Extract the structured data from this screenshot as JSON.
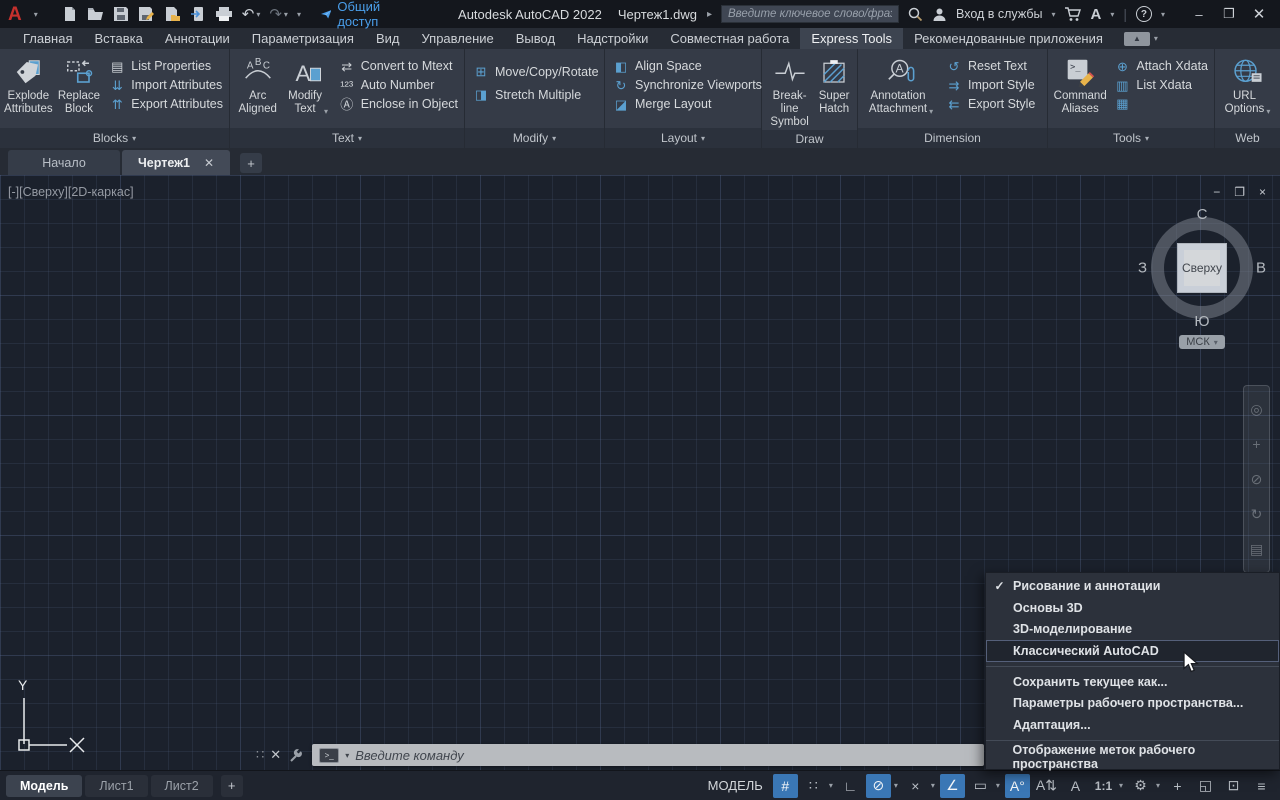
{
  "titlebar": {
    "share": "Общий доступ",
    "app_title": "Autodesk AutoCAD 2022",
    "doc_name": "Чертеж1.dwg",
    "search_placeholder": "Введите ключевое слово/фразу",
    "signin": "Вход в службы"
  },
  "icons": {
    "caret": "▾",
    "check": "✓",
    "undo": "↶",
    "redo": "↷",
    "grip": "∷",
    "minimize": "–",
    "restore": "❐",
    "close": "✕",
    "vp_minimize": "−",
    "vp_restore": "❐",
    "vp_close": "×",
    "arrow_right": "▸",
    "help": "?",
    "logo_a": "A",
    "autodesk_a": "A",
    "ribbon_min": "▲",
    "plus": "+",
    "prompt": ">_",
    "hamburger": "≡"
  },
  "menubar": {
    "tabs": [
      {
        "name": "tab-home",
        "label": "Главная"
      },
      {
        "name": "tab-insert",
        "label": "Вставка"
      },
      {
        "name": "tab-annotate",
        "label": "Аннотации"
      },
      {
        "name": "tab-parametric",
        "label": "Параметризация"
      },
      {
        "name": "tab-view",
        "label": "Вид"
      },
      {
        "name": "tab-manage",
        "label": "Управление"
      },
      {
        "name": "tab-output",
        "label": "Вывод"
      },
      {
        "name": "tab-addins",
        "label": "Надстройки"
      },
      {
        "name": "tab-collaborate",
        "label": "Совместная работа"
      },
      {
        "name": "tab-express-tools",
        "label": "Express Tools",
        "active": true
      },
      {
        "name": "tab-featured-apps",
        "label": "Рекомендованные приложения"
      }
    ]
  },
  "ribbon": {
    "panels": {
      "blocks": {
        "label": "Blocks",
        "caret": "▾",
        "big": [
          {
            "l1": "Explode",
            "l2": "Attributes"
          },
          {
            "l1": "Replace",
            "l2": "Block"
          }
        ],
        "small": [
          {
            "label": "List Properties",
            "glyph": "▤"
          },
          {
            "label": "Import Attributes",
            "glyph": "⇊"
          },
          {
            "label": "Export Attributes",
            "glyph": "⇈"
          }
        ]
      },
      "text": {
        "label": "Text",
        "caret": "▾",
        "big": [
          {
            "l1": "Arc",
            "l2": "Aligned"
          },
          {
            "l1": "Modify",
            "l2": "Text",
            "caret": "▾"
          }
        ],
        "small": [
          {
            "label": "Convert to Mtext",
            "glyph": "⇄"
          },
          {
            "label": "Auto Number",
            "glyph": "¹²³"
          },
          {
            "label": "Enclose in Object",
            "glyph": "Ⓐ"
          }
        ]
      },
      "modify": {
        "label": "Modify",
        "caret": "▾",
        "small": [
          {
            "label": "Move/Copy/Rotate",
            "glyph": "⊞"
          },
          {
            "label": "Stretch Multiple",
            "glyph": "◨"
          }
        ]
      },
      "layout": {
        "label": "Layout",
        "caret": "▾",
        "small": [
          {
            "label": "Align Space",
            "glyph": "◧"
          },
          {
            "label": "Synchronize Viewports",
            "glyph": "↻"
          },
          {
            "label": "Merge Layout",
            "glyph": "◪"
          }
        ]
      },
      "draw": {
        "label": "Draw",
        "big": [
          {
            "l1": "Break-line",
            "l2": "Symbol"
          },
          {
            "l1": "Super",
            "l2": "Hatch"
          }
        ]
      },
      "dimension": {
        "label": "Dimension",
        "big": [
          {
            "l1": "Annotation",
            "l2": "Attachment",
            "caret": "▾"
          }
        ],
        "small": [
          {
            "label": "Reset Text",
            "glyph": "↺"
          },
          {
            "label": "Import Style",
            "glyph": "⇉"
          },
          {
            "label": "Export Style",
            "glyph": "⇇"
          }
        ]
      },
      "tools": {
        "label": "Tools",
        "caret": "▾",
        "big": [
          {
            "l1": "Command",
            "l2": "Aliases"
          }
        ],
        "small": [
          {
            "label": "Attach Xdata",
            "glyph": "⊕"
          },
          {
            "label": "List Xdata",
            "glyph": "▥"
          },
          {
            "label": "",
            "glyph": "▦"
          }
        ]
      },
      "web": {
        "label": "Web",
        "big": [
          {
            "l1": "URL",
            "l2": "Options",
            "caret": "▾"
          }
        ]
      }
    }
  },
  "file_tabs": {
    "start": "Начало",
    "drawing": "Чертеж1",
    "close": "✕",
    "new": "+"
  },
  "viewport": {
    "control_minus": "[-]",
    "control_view": "[Сверху]",
    "control_visual": "[2D-каркас]",
    "viewcube": {
      "north": "С",
      "south": "Ю",
      "west": "З",
      "east": "В",
      "face": "Сверху",
      "ucs": "МСК"
    },
    "navbar": [
      {
        "name": "navigation-wheel-icon",
        "glyph": "◎"
      },
      {
        "name": "pan-icon",
        "glyph": "+"
      },
      {
        "name": "zoom-icon",
        "glyph": "⊘"
      },
      {
        "name": "orbit-icon",
        "glyph": "↻"
      },
      {
        "name": "show-motion-icon",
        "glyph": "▤"
      }
    ]
  },
  "command_line": {
    "placeholder": "Введите команду"
  },
  "workspace_menu": {
    "items": [
      {
        "name": "wm-drafting-annotation",
        "label": "Рисование и аннотации",
        "checked": "✓"
      },
      {
        "name": "wm-3d-basics",
        "label": "Основы 3D"
      },
      {
        "name": "wm-3d-modeling",
        "label": "3D-моделирование"
      },
      {
        "name": "wm-autocad-classic",
        "label": "Классический AutoCAD",
        "highlighted": true
      },
      {
        "sep": true
      },
      {
        "name": "wm-save-current-as",
        "label": "Сохранить текущее как..."
      },
      {
        "name": "wm-workspace-settings",
        "label": "Параметры рабочего пространства..."
      },
      {
        "name": "wm-customize",
        "label": "Адаптация..."
      },
      {
        "sep": true
      },
      {
        "name": "wm-display-workspace-labels",
        "label": "Отображение меток рабочего пространства"
      }
    ]
  },
  "statusbar": {
    "model_space": "МОДЕЛЬ",
    "layout_tabs": [
      {
        "name": "tab-model",
        "label": "Модель",
        "active": true
      },
      {
        "name": "tab-layout1",
        "label": "Лист1"
      },
      {
        "name": "tab-layout2",
        "label": "Лист2"
      }
    ],
    "new_layout": "+",
    "scale": "1:1",
    "toggles": [
      {
        "name": "grid-display-toggle",
        "glyph": "#",
        "active": true
      },
      {
        "name": "snap-mode-toggle",
        "glyph": "∷",
        "caret": "▾"
      },
      {
        "name": "ortho-mode-toggle",
        "glyph": "∟"
      },
      {
        "name": "polar-tracking-toggle",
        "glyph": "⊘",
        "active": true,
        "caret": "▾"
      },
      {
        "name": "object-snap-tracking-toggle",
        "glyph": "×",
        "caret": "▾"
      },
      {
        "name": "object-snap-toggle",
        "glyph": "∠",
        "active": true
      },
      {
        "name": "dynamic-input-toggle",
        "glyph": "▭",
        "caret": "▾"
      },
      {
        "name": "annotation-visibility-toggle",
        "glyph": "A°",
        "active": true
      },
      {
        "name": "annotation-autoscale-toggle",
        "glyph": "A⇅"
      },
      {
        "name": "annotation-scale-toggle",
        "glyph": "A"
      },
      {
        "name": "viewport-scale-button",
        "glyph": "1:1",
        "caret": "▾",
        "wide": true
      },
      {
        "name": "workspace-switching-button",
        "glyph": "⚙",
        "caret": "▾"
      },
      {
        "name": "crosshair-toggle",
        "glyph": "+"
      },
      {
        "name": "isolate-objects-toggle",
        "glyph": "◱"
      },
      {
        "name": "clean-screen-toggle",
        "glyph": "⊡"
      },
      {
        "name": "customization-button",
        "glyph": "≡"
      }
    ]
  },
  "colors": {
    "accent_blue": "#4a9eea",
    "toggle_active": "#3a77b5",
    "icon_blue": "#5ba0d0",
    "canvas_bg": "#1b212c"
  }
}
